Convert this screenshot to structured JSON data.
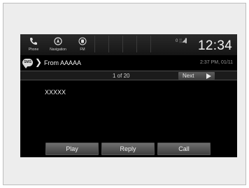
{
  "status_bar": {
    "items": [
      {
        "label": "Phone",
        "icon": "phone-icon"
      },
      {
        "label": "Navigation",
        "icon": "navigation-icon"
      },
      {
        "label": "FM",
        "icon": "radio-icon"
      }
    ],
    "signal": "0 ░◢▌",
    "clock": "12:34"
  },
  "message": {
    "icon_text": "SMS",
    "from": "From AAAAA",
    "timestamp": "2:37 PM, 01/11",
    "counter": "1 of 20",
    "next_label": "Next",
    "body": "XXXXX"
  },
  "actions": {
    "play": "Play",
    "reply": "Reply",
    "call": "Call"
  },
  "colors": {
    "screen_bg": "#000000",
    "button_bg": "#5a5a5a",
    "frame_bg": "#ededed"
  }
}
